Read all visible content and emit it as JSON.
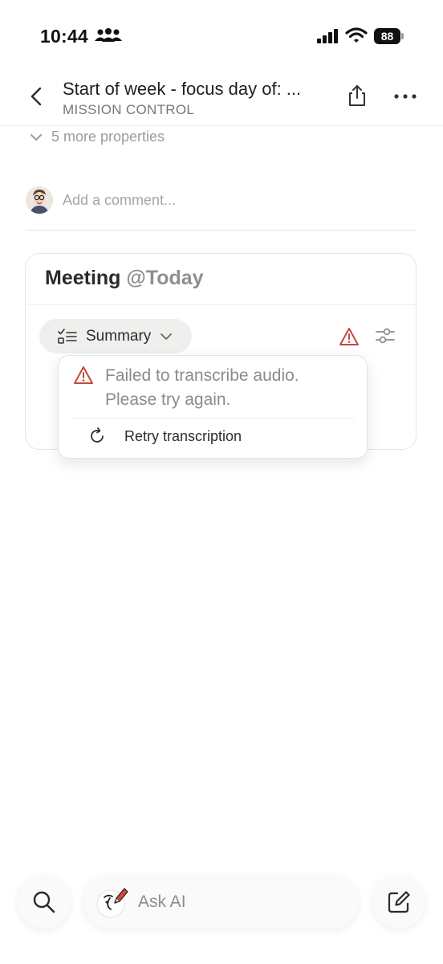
{
  "status_bar": {
    "time": "10:44",
    "battery": "88"
  },
  "header": {
    "title": "Start of week - focus day of: ...",
    "subtitle": "MISSION CONTROL"
  },
  "properties": {
    "more_label": "5 more properties"
  },
  "comment": {
    "placeholder": "Add a comment..."
  },
  "meeting": {
    "title": "Meeting",
    "date": "@Today",
    "summary_label": "Summary"
  },
  "popover": {
    "error_text": "Failed to transcribe audio. Please try again.",
    "retry_label": "Retry transcription"
  },
  "bottom_bar": {
    "ask_ai_label": "Ask AI"
  },
  "colors": {
    "warning": "#c9473b",
    "text": "#2f2f2f",
    "muted": "#8f8f8f"
  }
}
